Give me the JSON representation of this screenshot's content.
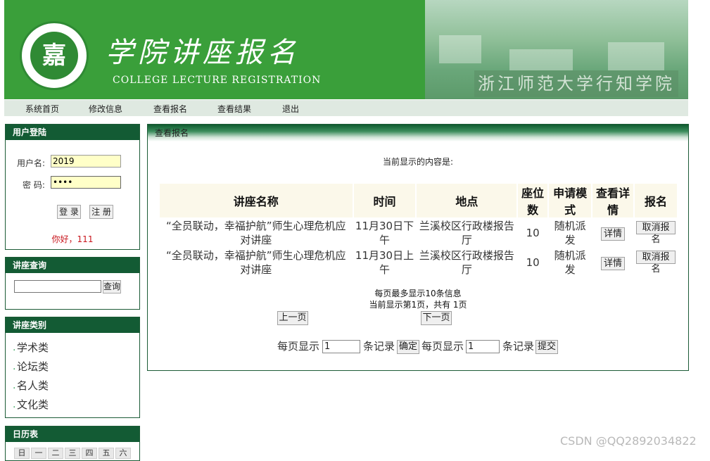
{
  "header": {
    "logo_text": "嘉",
    "title": "学院讲座报名",
    "subtitle": "COLLEGE   LECTURE   REGISTRATION",
    "photo_sign": "浙江师范大学行知学院"
  },
  "nav": {
    "items": [
      {
        "label": "系统首页"
      },
      {
        "label": "修改信息"
      },
      {
        "label": "查看报名"
      },
      {
        "label": "查看结果"
      },
      {
        "label": "退出"
      }
    ]
  },
  "login": {
    "heading": "用户登陆",
    "username_label": "用户名:",
    "username_value": "2019",
    "password_label": "密 码:",
    "password_value": "••••",
    "login_button": "登 录",
    "register_button": "注 册",
    "greeting": "你好，111"
  },
  "search": {
    "heading": "讲座查询",
    "button": "查询"
  },
  "categories": {
    "heading": "讲座类别",
    "items": [
      "学术类",
      "论坛类",
      "名人类",
      "文化类"
    ]
  },
  "calendar": {
    "heading": "日历表",
    "weekdays": [
      "日",
      "一",
      "二",
      "三",
      "四",
      "五",
      "六"
    ]
  },
  "main": {
    "heading": "查看报名",
    "current_label": "当前显示的内容是:",
    "columns": [
      "讲座名称",
      "时间",
      "地点",
      "座位数",
      "申请模式",
      "查看详情",
      "报名"
    ],
    "rows": [
      {
        "name": "“全员联动，幸福护航”师生心理危机应对讲座",
        "time": "11月30日下午",
        "place": "兰溪校区行政楼报告厅",
        "seats": "10",
        "mode": "随机派发",
        "detail_button": "详情",
        "signup_button": "取消报名"
      },
      {
        "name": "“全员联动，幸福护航”师生心理危机应对讲座",
        "time": "11月30日上午",
        "place": "兰溪校区行政楼报告厅",
        "seats": "10",
        "mode": "随机派发",
        "detail_button": "详情",
        "signup_button": "取消报名"
      }
    ],
    "page_max_note": "每页最多显示10条信息",
    "page_status": "当前显示第1页，共有 1页",
    "prev_button": "上一页",
    "next_button": "下一页",
    "perpage_label_1": "每页显示",
    "perpage_value_1": "1",
    "records_label_1": "条记录",
    "confirm_button": "确定",
    "perpage_label_2": "每页显示",
    "perpage_value_2": "1",
    "records_label_2": "条记录",
    "submit_button": "提交"
  },
  "watermark": "CSDN @QQ2892034822"
}
